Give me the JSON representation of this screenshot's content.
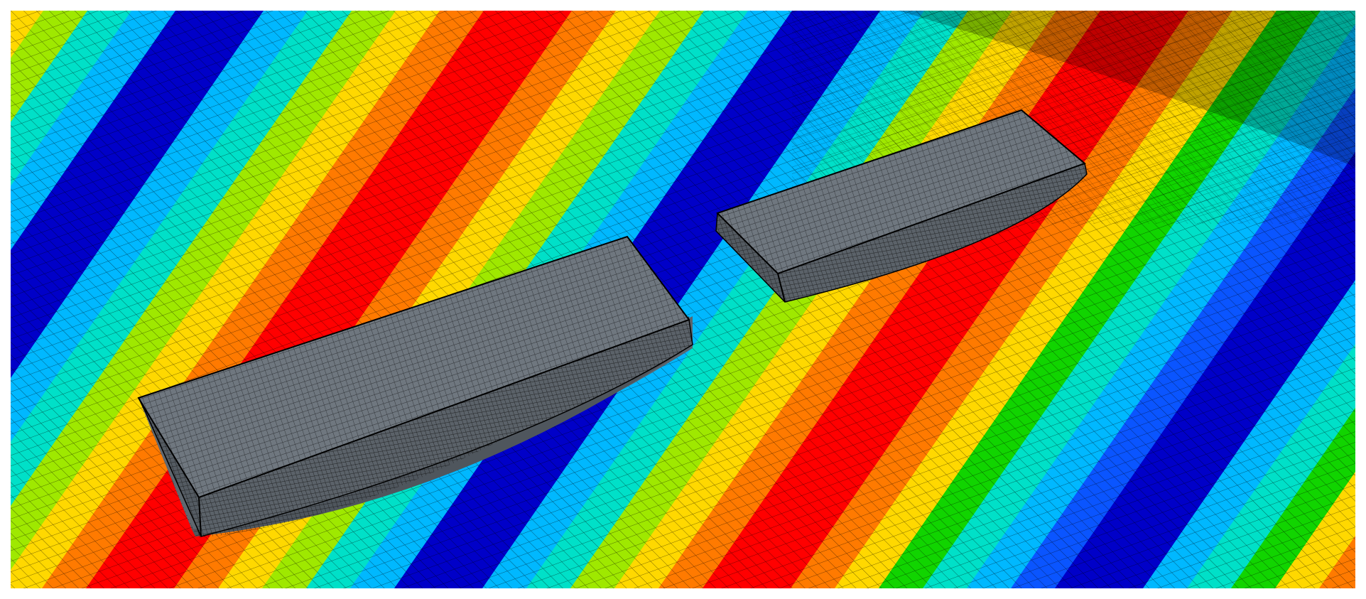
{
  "image": {
    "subject": "",
    "colormap": [
      "#ff0000",
      "#ff7a00",
      "#ffd800",
      "#9fe800",
      "#11d400",
      "#00e0c8",
      "#00b8ff",
      "#0a55ff",
      "#0000c8"
    ],
    "mesh_line_color": "#000000",
    "body_color": "#6d757d",
    "body_edge_color": "#000000"
  }
}
